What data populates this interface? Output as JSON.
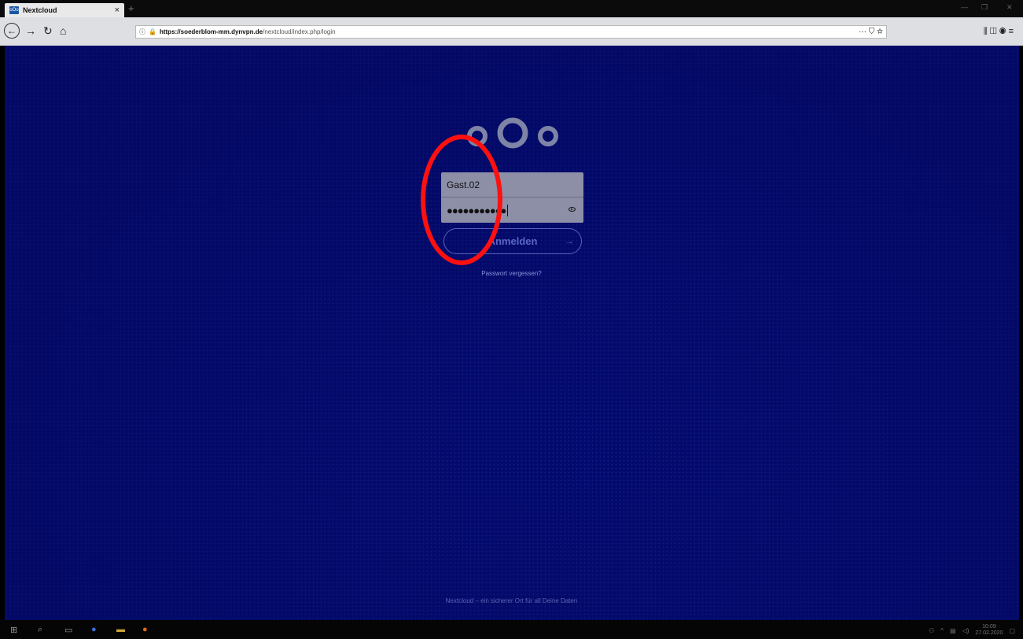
{
  "browser": {
    "tab_title": "Nextcloud",
    "tab_close": "×",
    "new_tab": "+",
    "url_domain": "https://soederblom-mm.dynvpn.de",
    "url_path": "/nextcloud/index.php/login",
    "url_actions": "··· ⛉ ☆",
    "toolbar_icons": "⫼ ◫ ◉ ≡"
  },
  "login": {
    "username": "Gast.02",
    "password_mask": "●●●●●●●●●●●",
    "submit_label": "Anmelden",
    "submit_arrow": "→",
    "forgot_password": "Passwort vergessen?"
  },
  "footer": {
    "text": "Nextcloud – ein sicherer Ort für all Deine Daten"
  },
  "taskbar": {
    "time": "10:09",
    "date": "27.02.2020"
  },
  "colors": {
    "page_background": "#030a6e",
    "annotation_ring": "#ff1010",
    "accent": "#5c66c4"
  }
}
